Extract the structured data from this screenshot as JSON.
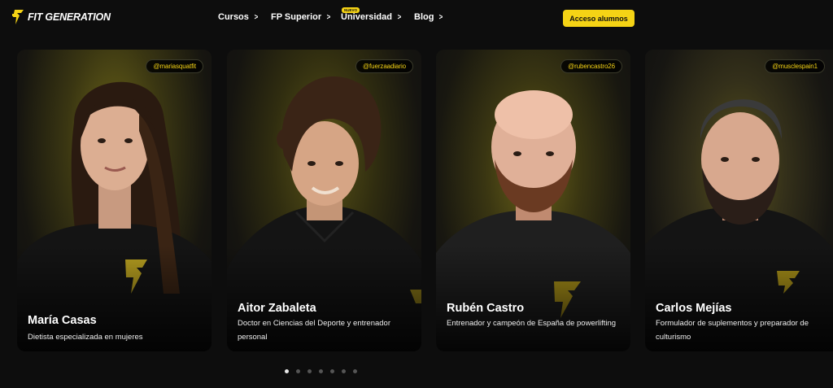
{
  "brand": {
    "name": "FIT GENERATION",
    "accent": "#f5d315"
  },
  "nav": {
    "items": [
      {
        "label": "Cursos"
      },
      {
        "label": "FP Superior"
      },
      {
        "label": "Universidad"
      },
      {
        "label": "Blog"
      }
    ],
    "badge": "NUEVO",
    "cta": "Acceso alumnos"
  },
  "cards": [
    {
      "handle": "@mariasquatfit",
      "name": "María Casas",
      "desc": "Dietista especializada en mujeres"
    },
    {
      "handle": "@fuerzaadiario",
      "name": "Aitor Zabaleta",
      "desc": "Doctor en Ciencias del Deporte y entrenador personal"
    },
    {
      "handle": "@rubencastro26",
      "name": "Rubén Castro",
      "desc": "Entrenador y campeón de España de powerlifting"
    },
    {
      "handle": "@musclespain1",
      "name": "Carlos Mejías",
      "desc": "Formulador de suplementos y preparador de culturismo"
    }
  ],
  "carousel": {
    "slides": 7,
    "active_index": 0
  }
}
